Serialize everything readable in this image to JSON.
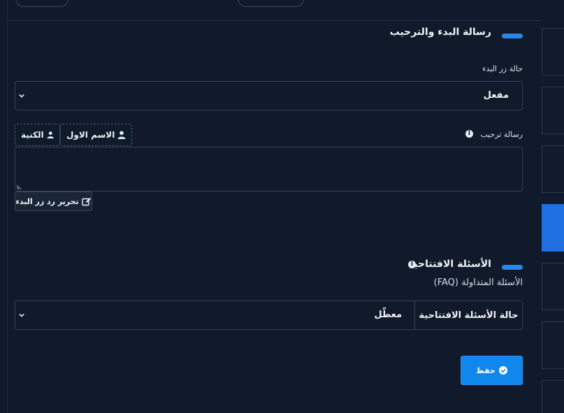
{
  "welcome_section": {
    "title": "رسالة البدء والترحيب",
    "start_button_status_label": "حالة زر البدء",
    "start_button_status_value": "مفعل",
    "welcome_message_label": "رسالة ترحيب",
    "welcome_message_value": "",
    "variables": [
      {
        "label": "الاسم الاول"
      },
      {
        "label": "الكنية"
      }
    ],
    "edit_reply_label": "تحرير رد زر البدء"
  },
  "faq_section": {
    "title": "الأسئلة الافتتاحية",
    "subtitle": "الأسئلة المتداولة (FAQ)",
    "status_label": "حالة الأسئلة الافتتاحية",
    "status_value": "معطّل"
  },
  "save_label": "حفظ",
  "colors": {
    "background": "#101a2b",
    "accent": "#2b86e6",
    "primary_button": "#0f87ec",
    "active_tile": "#1f6fe0"
  },
  "icons": {
    "info": "info-circle-icon",
    "user": "user-icon",
    "edit": "edit-icon",
    "check": "check-circle-icon",
    "dropdown": "chevron-down-icon"
  }
}
